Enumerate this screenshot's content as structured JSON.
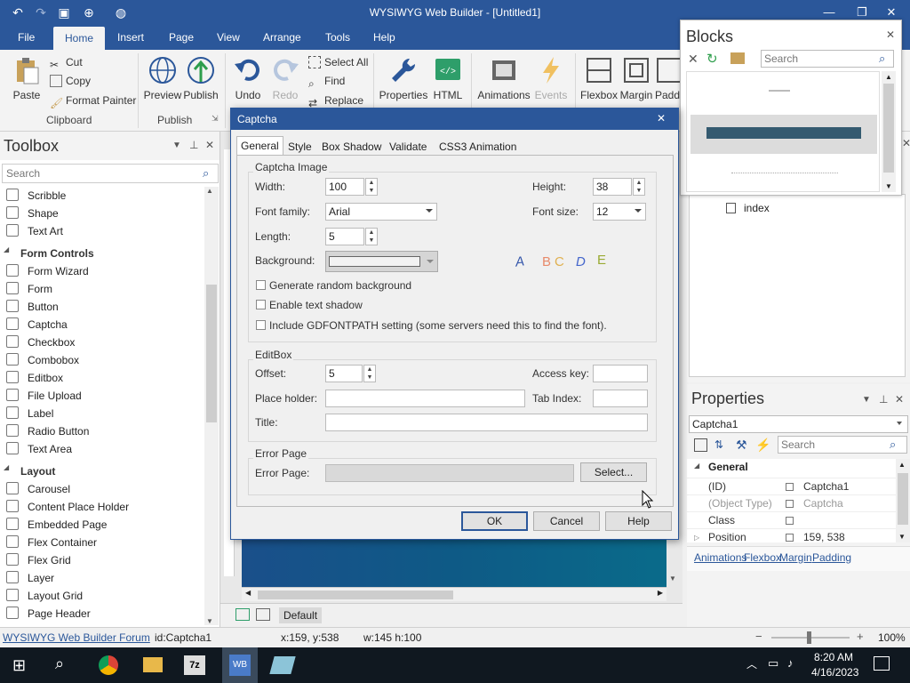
{
  "app": {
    "title": "WYSIWYG Web Builder - [Untitled1]"
  },
  "menu": {
    "tabs": [
      "File",
      "Home",
      "Insert",
      "Page",
      "View",
      "Arrange",
      "Tools",
      "Help"
    ]
  },
  "ribbon": {
    "clipboard": {
      "paste": "Paste",
      "cut": "Cut",
      "copy": "Copy",
      "format_painter": "Format Painter",
      "group": "Clipboard"
    },
    "publish": {
      "preview": "Preview",
      "publish": "Publish",
      "group": "Publish"
    },
    "edit": {
      "undo": "Undo",
      "redo": "Redo",
      "select_all": "Select All",
      "find": "Find",
      "replace": "Replace"
    },
    "props": {
      "properties": "Properties",
      "html": "HTML"
    },
    "anim": {
      "animations": "Animations",
      "events": "Events"
    },
    "layout": {
      "flexbox": "Flexbox",
      "margin": "Margin",
      "padding": "Padd"
    }
  },
  "toolbox": {
    "title": "Toolbox",
    "search_placeholder": "Search",
    "top_items": [
      "Scribble",
      "Shape",
      "Text Art"
    ],
    "form_controls": "Form Controls",
    "form_items": [
      "Form Wizard",
      "Form",
      "Button",
      "Captcha",
      "Checkbox",
      "Combobox",
      "Editbox",
      "File Upload",
      "Label",
      "Radio Button",
      "Text Area"
    ],
    "layout": "Layout",
    "layout_items": [
      "Carousel",
      "Content Place Holder",
      "Embedded Page",
      "Flex Container",
      "Flex Grid",
      "Layer",
      "Layout Grid",
      "Page Header"
    ]
  },
  "blocks": {
    "title": "Blocks",
    "search_placeholder": "Search",
    "tree_item": "index"
  },
  "properties": {
    "title": "Properties",
    "selected": "Captcha1",
    "search_placeholder": "Search",
    "category": "General",
    "rows": [
      {
        "name": "(ID)",
        "value": "Captcha1"
      },
      {
        "name": "(Object Type)",
        "value": "Captcha"
      },
      {
        "name": "Class",
        "value": ""
      },
      {
        "name": "Position",
        "value": "159, 538"
      }
    ],
    "links": [
      "Animations",
      "Flexbox",
      "Margin",
      "Padding"
    ]
  },
  "canvas": {
    "page_tab": "Default"
  },
  "status": {
    "forum": "WYSIWYG Web Builder Forum",
    "id": "id:Captcha1",
    "coords": "x:159, y:538",
    "size": "w:145 h:100",
    "zoom": "100%"
  },
  "taskbar": {
    "time": "8:20 AM",
    "date": "4/16/2023"
  },
  "dialog": {
    "title": "Captcha",
    "tabs": [
      "General",
      "Style",
      "Box Shadow",
      "Validate",
      "CSS3 Animation"
    ],
    "captcha_image": {
      "legend": "Captcha Image",
      "width_label": "Width:",
      "width": "100",
      "height_label": "Height:",
      "height": "38",
      "font_family_label": "Font family:",
      "font_family": "Arial",
      "font_size_label": "Font size:",
      "font_size": "12",
      "length_label": "Length:",
      "length": "5",
      "background_label": "Background:",
      "preview_chars": [
        "A",
        "B",
        "C",
        "D",
        "E"
      ],
      "chk_random": "Generate random background",
      "chk_shadow": "Enable text shadow",
      "chk_gdfont": "Include GDFONTPATH setting (some servers need this to find the font)."
    },
    "editbox": {
      "legend": "EditBox",
      "offset_label": "Offset:",
      "offset": "5",
      "access_key_label": "Access key:",
      "placeholder_label": "Place holder:",
      "tab_index_label": "Tab Index:",
      "title_label": "Title:"
    },
    "error_page": {
      "legend": "Error Page",
      "label": "Error Page:",
      "select": "Select..."
    },
    "buttons": {
      "ok": "OK",
      "cancel": "Cancel",
      "help": "Help"
    }
  },
  "colors": {
    "accent": "#2b579a",
    "canvas_band": "#0e5a86"
  }
}
